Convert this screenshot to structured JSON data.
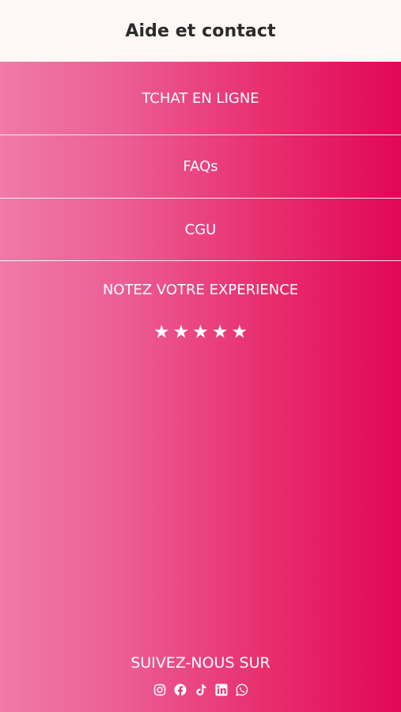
{
  "header": {
    "title": "Aide et contact"
  },
  "menu": {
    "items": [
      {
        "label": "TCHAT EN LIGNE"
      },
      {
        "label": "FAQs"
      },
      {
        "label": "CGU"
      }
    ]
  },
  "rating": {
    "title": "NOTEZ VOTRE EXPERIENCE",
    "star_glyph": "★",
    "stars_count": 5
  },
  "social": {
    "title": "SUIVEZ-NOUS SUR",
    "icons": [
      "instagram-icon",
      "facebook-icon",
      "tiktok-icon",
      "linkedin-icon",
      "whatsapp-icon"
    ]
  },
  "colors": {
    "header_bg": "#fdf7f6",
    "title_text": "#2b2b2b",
    "gradient_left": "#f07aaa",
    "gradient_right": "#e10757",
    "panel_text": "#ffffff"
  }
}
